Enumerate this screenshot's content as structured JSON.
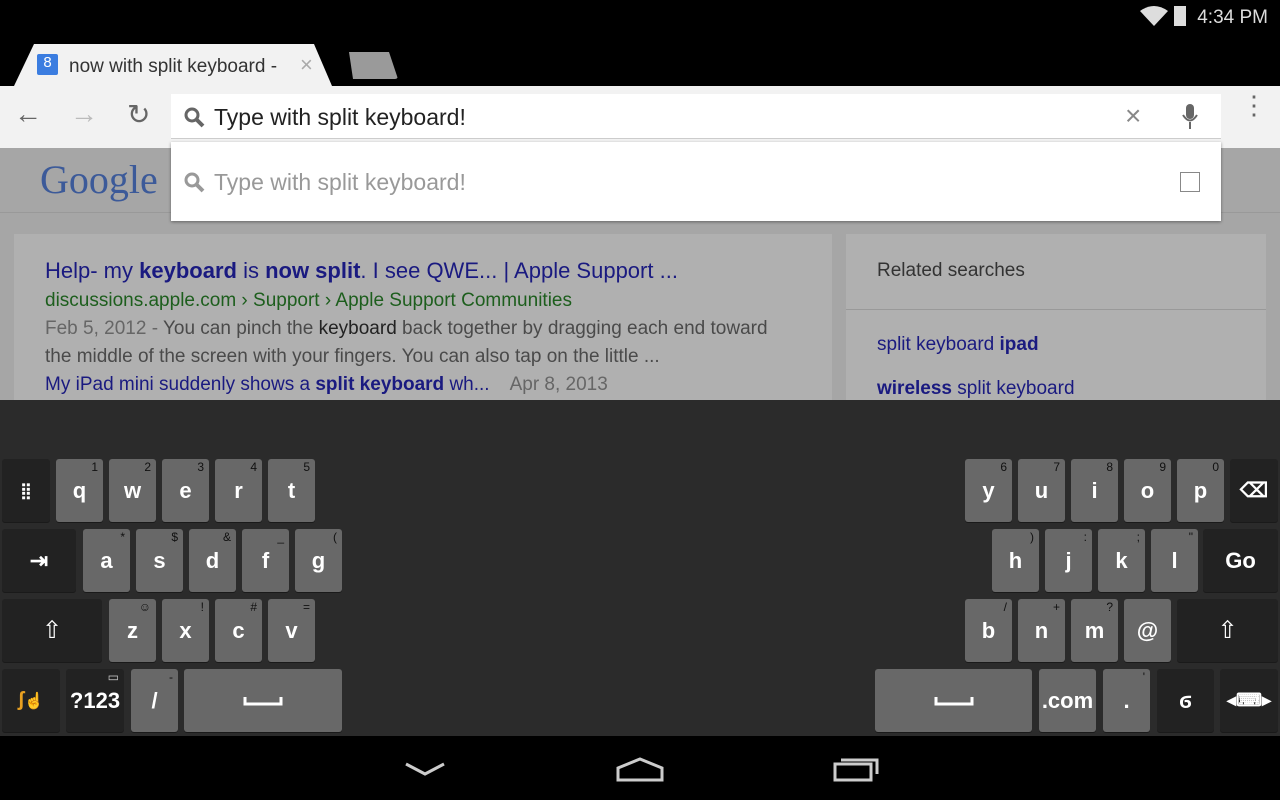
{
  "status": {
    "time": "4:34 PM",
    "icons": [
      "wifi-icon",
      "battery-icon"
    ]
  },
  "tab": {
    "title": "now with split keyboard -",
    "favicon": "8"
  },
  "omnibox": {
    "value": "Type with split keyboard!"
  },
  "suggestion": {
    "text": "Type with split keyboard!"
  },
  "page": {
    "logo": "Google",
    "result": {
      "title_parts": [
        "Help- my ",
        "keyboard",
        " is ",
        "now split",
        ". I see QWE... | Apple Support ..."
      ],
      "url": "discussions.apple.com › Support › Apple Support Communities",
      "snippet_date": "Feb 5, 2012 - ",
      "snippet_a": "You can pinch the ",
      "snippet_b": "keyboard",
      "snippet_c": " back together by dragging each end toward",
      "snippet_line2": "the middle of the screen with your fingers. You can also tap on the little ...",
      "sublink_a": "My iPad mini suddenly shows a ",
      "sublink_b": "split keyboard",
      "sublink_c": " wh...",
      "sublink_date": "Apr 8, 2013"
    },
    "related": {
      "heading": "Related searches",
      "items": [
        [
          "split keyboard ",
          "ipad"
        ],
        [
          "wireless",
          " split keyboard"
        ]
      ]
    }
  },
  "keyboard": {
    "left": [
      {
        "label": "",
        "hint": "",
        "icon": "keypad-icon",
        "fn": true
      },
      {
        "label": "q",
        "hint": "1"
      },
      {
        "label": "w",
        "hint": "2"
      },
      {
        "label": "e",
        "hint": "3"
      },
      {
        "label": "r",
        "hint": "4"
      },
      {
        "label": "t",
        "hint": "5"
      },
      {
        "label": "",
        "hint": "",
        "icon": "tab-icon",
        "fn": true
      },
      {
        "label": "a",
        "hint": "*"
      },
      {
        "label": "s",
        "hint": "$"
      },
      {
        "label": "d",
        "hint": "&"
      },
      {
        "label": "f",
        "hint": "_"
      },
      {
        "label": "g",
        "hint": "("
      },
      {
        "label": "",
        "hint": "",
        "icon": "shift-icon",
        "fn": true
      },
      {
        "label": "z",
        "hint": "☺"
      },
      {
        "label": "x",
        "hint": "!"
      },
      {
        "label": "c",
        "hint": "#"
      },
      {
        "label": "v",
        "hint": "="
      },
      {
        "label": "",
        "hint": "",
        "icon": "swype-icon",
        "fn": true
      },
      {
        "label": "?123",
        "hint": "▭",
        "fn": true
      },
      {
        "label": "/",
        "hint": "-"
      },
      {
        "label": "",
        "hint": "",
        "icon": "space-icon"
      }
    ],
    "right": [
      {
        "label": "y",
        "hint": "6"
      },
      {
        "label": "u",
        "hint": "7"
      },
      {
        "label": "i",
        "hint": "8"
      },
      {
        "label": "o",
        "hint": "9"
      },
      {
        "label": "p",
        "hint": "0"
      },
      {
        "label": "",
        "hint": "",
        "icon": "backspace-icon",
        "fn": true
      },
      {
        "label": "h",
        "hint": ")"
      },
      {
        "label": "j",
        "hint": ":"
      },
      {
        "label": "k",
        "hint": ";"
      },
      {
        "label": "l",
        "hint": "\""
      },
      {
        "label": "Go",
        "hint": "",
        "fn": true
      },
      {
        "label": "b",
        "hint": "/"
      },
      {
        "label": "n",
        "hint": "+"
      },
      {
        "label": "m",
        "hint": "?"
      },
      {
        "label": "@",
        "hint": ""
      },
      {
        "label": "",
        "hint": "",
        "icon": "shift-icon",
        "fn": true
      },
      {
        "label": "",
        "hint": "",
        "icon": "space-icon"
      },
      {
        "label": ".com",
        "hint": ""
      },
      {
        "label": ".",
        "hint": "'"
      },
      {
        "label": "",
        "hint": "",
        "icon": "dragon-mic-icon",
        "fn": true
      },
      {
        "label": "",
        "hint": "",
        "icon": "keyboard-move-icon",
        "fn": true
      }
    ]
  },
  "nav": {
    "icons": [
      "back-icon",
      "home-icon",
      "recents-icon"
    ]
  }
}
